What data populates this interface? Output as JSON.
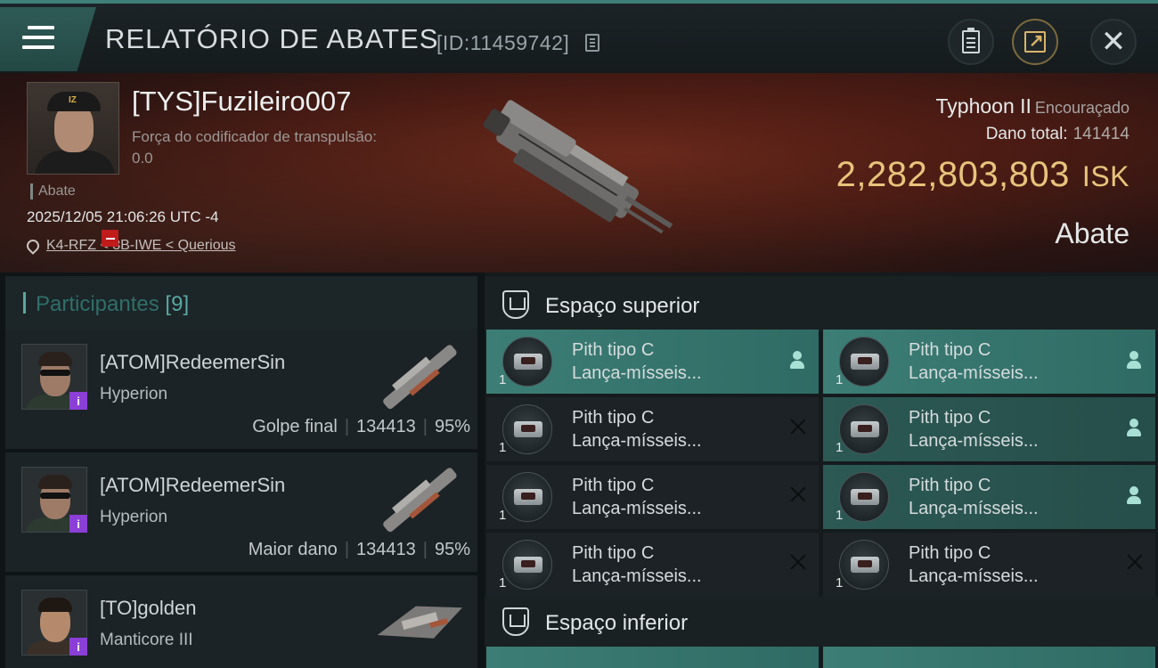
{
  "header": {
    "title": "RELATÓRIO DE ABATES",
    "id_label": "[ID:11459742]",
    "icons": [
      "menu-icon",
      "copy-icon",
      "clipboard-icon",
      "share-icon",
      "close-icon"
    ]
  },
  "victim": {
    "name": "[TYS]Fuzileiro007",
    "attr_label": "Força do codificador de transpulsão:",
    "attr_value": "0.0",
    "tag": "Abate",
    "datetime": "2025/12/05 21:06:26 UTC -4",
    "location": "K4-RFZ < 3B-IWE < Querious",
    "ship_name": "Typhoon II",
    "ship_class": "Encouraçado",
    "damage_label": "Dano total:",
    "damage_value": "141414",
    "isk_value": "2,282,803,803",
    "isk_unit": "ISK",
    "result": "Abate"
  },
  "participants": {
    "label": "Participantes",
    "count": "[9]",
    "items": [
      {
        "name": "[ATOM]RedeemerSin",
        "ship": "Hyperion",
        "role": "Golpe final",
        "damage": "134413",
        "percent": "95%",
        "badge": "i"
      },
      {
        "name": "[ATOM]RedeemerSin",
        "ship": "Hyperion",
        "role": "Maior dano",
        "damage": "134413",
        "percent": "95%",
        "badge": "i"
      },
      {
        "name": "[TO]golden",
        "ship": "Manticore III",
        "badge": "i"
      }
    ]
  },
  "slots": {
    "upper_label": "Espaço superior",
    "lower_label": "Espaço inferior",
    "upper": [
      {
        "name": "Pith tipo C",
        "type": "Lança-mísseis...",
        "qty": "1",
        "status": "person",
        "active": true
      },
      {
        "name": "Pith tipo C",
        "type": "Lança-mísseis...",
        "qty": "1",
        "status": "person",
        "active": true
      },
      {
        "name": "Pith tipo C",
        "type": "Lança-mísseis...",
        "qty": "1",
        "status": "x",
        "active": false
      },
      {
        "name": "Pith tipo C",
        "type": "Lança-mísseis...",
        "qty": "1",
        "status": "person",
        "active": true
      },
      {
        "name": "Pith tipo C",
        "type": "Lança-mísseis...",
        "qty": "1",
        "status": "x",
        "active": false
      },
      {
        "name": "Pith tipo C",
        "type": "Lança-mísseis...",
        "qty": "1",
        "status": "person",
        "active": true
      },
      {
        "name": "Pith tipo C",
        "type": "Lança-mísseis...",
        "qty": "1",
        "status": "x",
        "active": false
      },
      {
        "name": "Pith tipo C",
        "type": "Lança-mísseis...",
        "qty": "1",
        "status": "x",
        "active": false
      }
    ]
  },
  "colors": {
    "accent": "#3c7e76",
    "isk": "#e8c37c",
    "corp_badge": "#8b3fd6",
    "danger": "#c01c1c"
  }
}
